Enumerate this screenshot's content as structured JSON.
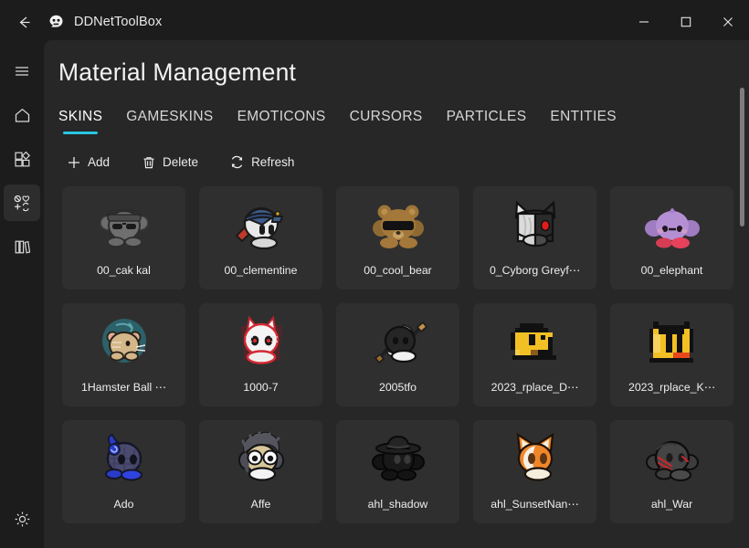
{
  "window": {
    "title": "DDNetToolBox",
    "back_label": "back-arrow",
    "minimize_label": "minimize",
    "maximize_label": "maximize",
    "close_label": "close"
  },
  "sidebar": {
    "items": [
      {
        "name": "menu",
        "icon": "hamburger-menu-icon",
        "active": false
      },
      {
        "name": "home",
        "icon": "home-icon",
        "active": false
      },
      {
        "name": "packages",
        "icon": "grid-widgets-icon",
        "active": false
      },
      {
        "name": "material",
        "icon": "material-management-icon",
        "active": true
      },
      {
        "name": "library",
        "icon": "library-books-icon",
        "active": false
      }
    ],
    "bottom": {
      "name": "settings",
      "icon": "gear-icon"
    }
  },
  "page": {
    "title": "Material Management"
  },
  "tabs": [
    {
      "label": "SKINS",
      "active": true
    },
    {
      "label": "GAMESKINS",
      "active": false
    },
    {
      "label": "EMOTICONS",
      "active": false
    },
    {
      "label": "CURSORS",
      "active": false
    },
    {
      "label": "PARTICLES",
      "active": false
    },
    {
      "label": "ENTITIES",
      "active": false
    }
  ],
  "toolbar": [
    {
      "label": "Add",
      "icon": "plus-icon"
    },
    {
      "label": "Delete",
      "icon": "trash-icon"
    },
    {
      "label": "Refresh",
      "icon": "refresh-icon"
    }
  ],
  "colors": {
    "accent": "#27c6e0",
    "window_bg": "#1c1c1c",
    "content_bg": "#272727",
    "card_bg": "#2f2f2f",
    "text": "#ececec"
  },
  "grid": {
    "items": [
      {
        "label": "00_cak kal",
        "art": "cak-kal"
      },
      {
        "label": "00_clementine",
        "art": "clementine"
      },
      {
        "label": "00_cool_bear",
        "art": "cool-bear"
      },
      {
        "label": "0_Cyborg Greyf⋯",
        "art": "cyborg-greyfox"
      },
      {
        "label": "00_elephant",
        "art": "elephant"
      },
      {
        "label": "1Hamster Ball ⋯",
        "art": "hamster-ball"
      },
      {
        "label": "1000-7",
        "art": "cat-1000-7"
      },
      {
        "label": "2005tfo",
        "art": "tfo-2005"
      },
      {
        "label": "2023_rplace_D⋯",
        "art": "rplace-d"
      },
      {
        "label": "2023_rplace_K⋯",
        "art": "rplace-k"
      },
      {
        "label": "Ado",
        "art": "ado"
      },
      {
        "label": "Affe",
        "art": "affe"
      },
      {
        "label": "ahl_shadow",
        "art": "ahl-shadow"
      },
      {
        "label": "ahl_SunsetNan⋯",
        "art": "ahl-sunset-fox"
      },
      {
        "label": "ahl_War",
        "art": "ahl-war"
      }
    ]
  }
}
